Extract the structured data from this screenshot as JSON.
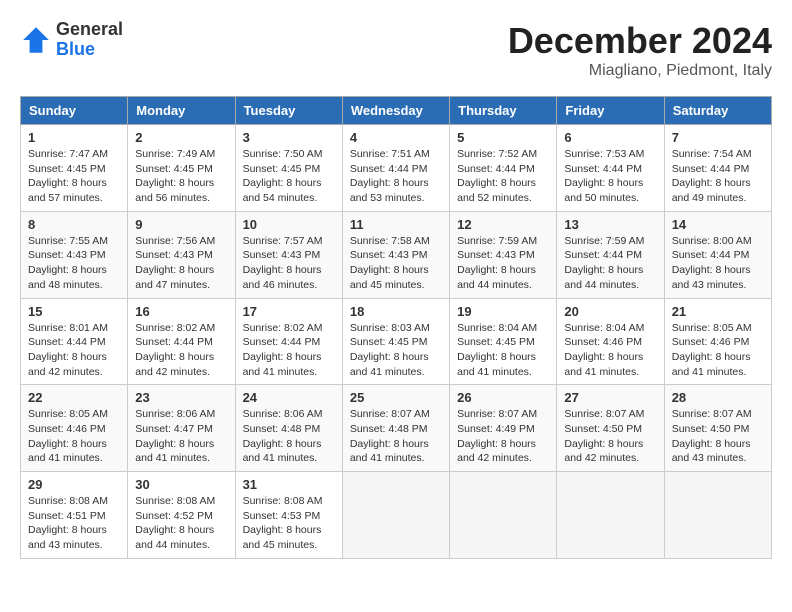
{
  "logo": {
    "general": "General",
    "blue": "Blue"
  },
  "header": {
    "month": "December 2024",
    "location": "Miagliano, Piedmont, Italy"
  },
  "weekdays": [
    "Sunday",
    "Monday",
    "Tuesday",
    "Wednesday",
    "Thursday",
    "Friday",
    "Saturday"
  ],
  "weeks": [
    [
      {
        "day": "1",
        "sunrise": "Sunrise: 7:47 AM",
        "sunset": "Sunset: 4:45 PM",
        "daylight": "Daylight: 8 hours and 57 minutes."
      },
      {
        "day": "2",
        "sunrise": "Sunrise: 7:49 AM",
        "sunset": "Sunset: 4:45 PM",
        "daylight": "Daylight: 8 hours and 56 minutes."
      },
      {
        "day": "3",
        "sunrise": "Sunrise: 7:50 AM",
        "sunset": "Sunset: 4:45 PM",
        "daylight": "Daylight: 8 hours and 54 minutes."
      },
      {
        "day": "4",
        "sunrise": "Sunrise: 7:51 AM",
        "sunset": "Sunset: 4:44 PM",
        "daylight": "Daylight: 8 hours and 53 minutes."
      },
      {
        "day": "5",
        "sunrise": "Sunrise: 7:52 AM",
        "sunset": "Sunset: 4:44 PM",
        "daylight": "Daylight: 8 hours and 52 minutes."
      },
      {
        "day": "6",
        "sunrise": "Sunrise: 7:53 AM",
        "sunset": "Sunset: 4:44 PM",
        "daylight": "Daylight: 8 hours and 50 minutes."
      },
      {
        "day": "7",
        "sunrise": "Sunrise: 7:54 AM",
        "sunset": "Sunset: 4:44 PM",
        "daylight": "Daylight: 8 hours and 49 minutes."
      }
    ],
    [
      {
        "day": "8",
        "sunrise": "Sunrise: 7:55 AM",
        "sunset": "Sunset: 4:43 PM",
        "daylight": "Daylight: 8 hours and 48 minutes."
      },
      {
        "day": "9",
        "sunrise": "Sunrise: 7:56 AM",
        "sunset": "Sunset: 4:43 PM",
        "daylight": "Daylight: 8 hours and 47 minutes."
      },
      {
        "day": "10",
        "sunrise": "Sunrise: 7:57 AM",
        "sunset": "Sunset: 4:43 PM",
        "daylight": "Daylight: 8 hours and 46 minutes."
      },
      {
        "day": "11",
        "sunrise": "Sunrise: 7:58 AM",
        "sunset": "Sunset: 4:43 PM",
        "daylight": "Daylight: 8 hours and 45 minutes."
      },
      {
        "day": "12",
        "sunrise": "Sunrise: 7:59 AM",
        "sunset": "Sunset: 4:43 PM",
        "daylight": "Daylight: 8 hours and 44 minutes."
      },
      {
        "day": "13",
        "sunrise": "Sunrise: 7:59 AM",
        "sunset": "Sunset: 4:44 PM",
        "daylight": "Daylight: 8 hours and 44 minutes."
      },
      {
        "day": "14",
        "sunrise": "Sunrise: 8:00 AM",
        "sunset": "Sunset: 4:44 PM",
        "daylight": "Daylight: 8 hours and 43 minutes."
      }
    ],
    [
      {
        "day": "15",
        "sunrise": "Sunrise: 8:01 AM",
        "sunset": "Sunset: 4:44 PM",
        "daylight": "Daylight: 8 hours and 42 minutes."
      },
      {
        "day": "16",
        "sunrise": "Sunrise: 8:02 AM",
        "sunset": "Sunset: 4:44 PM",
        "daylight": "Daylight: 8 hours and 42 minutes."
      },
      {
        "day": "17",
        "sunrise": "Sunrise: 8:02 AM",
        "sunset": "Sunset: 4:44 PM",
        "daylight": "Daylight: 8 hours and 41 minutes."
      },
      {
        "day": "18",
        "sunrise": "Sunrise: 8:03 AM",
        "sunset": "Sunset: 4:45 PM",
        "daylight": "Daylight: 8 hours and 41 minutes."
      },
      {
        "day": "19",
        "sunrise": "Sunrise: 8:04 AM",
        "sunset": "Sunset: 4:45 PM",
        "daylight": "Daylight: 8 hours and 41 minutes."
      },
      {
        "day": "20",
        "sunrise": "Sunrise: 8:04 AM",
        "sunset": "Sunset: 4:46 PM",
        "daylight": "Daylight: 8 hours and 41 minutes."
      },
      {
        "day": "21",
        "sunrise": "Sunrise: 8:05 AM",
        "sunset": "Sunset: 4:46 PM",
        "daylight": "Daylight: 8 hours and 41 minutes."
      }
    ],
    [
      {
        "day": "22",
        "sunrise": "Sunrise: 8:05 AM",
        "sunset": "Sunset: 4:46 PM",
        "daylight": "Daylight: 8 hours and 41 minutes."
      },
      {
        "day": "23",
        "sunrise": "Sunrise: 8:06 AM",
        "sunset": "Sunset: 4:47 PM",
        "daylight": "Daylight: 8 hours and 41 minutes."
      },
      {
        "day": "24",
        "sunrise": "Sunrise: 8:06 AM",
        "sunset": "Sunset: 4:48 PM",
        "daylight": "Daylight: 8 hours and 41 minutes."
      },
      {
        "day": "25",
        "sunrise": "Sunrise: 8:07 AM",
        "sunset": "Sunset: 4:48 PM",
        "daylight": "Daylight: 8 hours and 41 minutes."
      },
      {
        "day": "26",
        "sunrise": "Sunrise: 8:07 AM",
        "sunset": "Sunset: 4:49 PM",
        "daylight": "Daylight: 8 hours and 42 minutes."
      },
      {
        "day": "27",
        "sunrise": "Sunrise: 8:07 AM",
        "sunset": "Sunset: 4:50 PM",
        "daylight": "Daylight: 8 hours and 42 minutes."
      },
      {
        "day": "28",
        "sunrise": "Sunrise: 8:07 AM",
        "sunset": "Sunset: 4:50 PM",
        "daylight": "Daylight: 8 hours and 43 minutes."
      }
    ],
    [
      {
        "day": "29",
        "sunrise": "Sunrise: 8:08 AM",
        "sunset": "Sunset: 4:51 PM",
        "daylight": "Daylight: 8 hours and 43 minutes."
      },
      {
        "day": "30",
        "sunrise": "Sunrise: 8:08 AM",
        "sunset": "Sunset: 4:52 PM",
        "daylight": "Daylight: 8 hours and 44 minutes."
      },
      {
        "day": "31",
        "sunrise": "Sunrise: 8:08 AM",
        "sunset": "Sunset: 4:53 PM",
        "daylight": "Daylight: 8 hours and 45 minutes."
      },
      null,
      null,
      null,
      null
    ]
  ]
}
